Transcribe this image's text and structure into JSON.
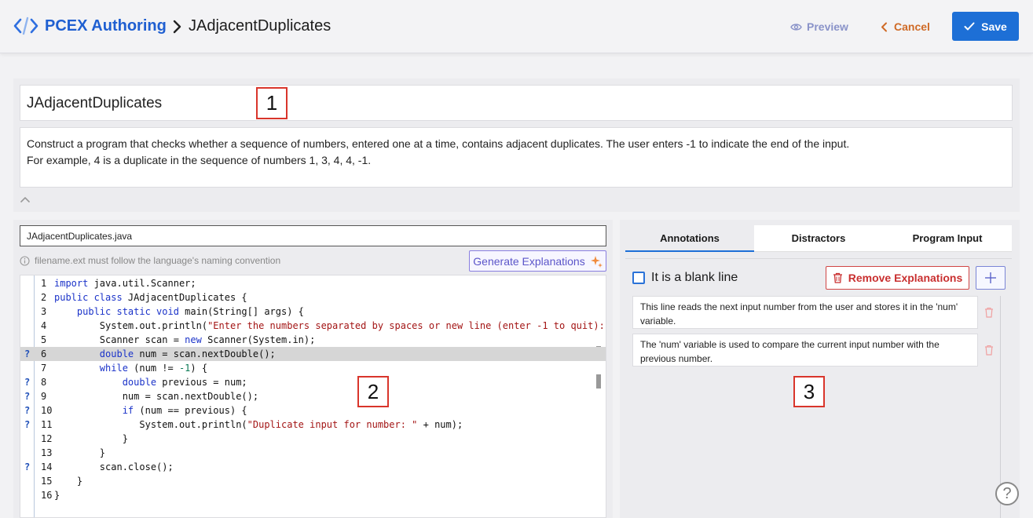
{
  "header": {
    "app_name": "PCEX Authoring",
    "breadcrumb_current": "JAdjacentDuplicates",
    "preview_label": "Preview",
    "cancel_label": "Cancel",
    "save_label": "Save"
  },
  "problem": {
    "title": "JAdjacentDuplicates",
    "description_line1": "Construct a program that checks whether a sequence of numbers, entered one at a time, contains adjacent duplicates. The user enters -1 to indicate the end of the input.",
    "description_line2": "For example, 4 is a duplicate in the sequence of numbers 1, 3, 4, 4, -1."
  },
  "editor": {
    "filename": "JAdjacentDuplicates.java",
    "filename_hint": "filename.ext must follow the language's naming convention",
    "generate_label": "Generate Explanations",
    "highlighted_line": 6,
    "lines": [
      {
        "n": "1",
        "marker": "",
        "indent": "",
        "segs": [
          [
            "kw",
            "import"
          ],
          [
            "t",
            " java.util.Scanner;"
          ]
        ]
      },
      {
        "n": "2",
        "marker": "",
        "indent": "",
        "segs": [
          [
            "kw",
            "public class"
          ],
          [
            "t",
            " JAdjacentDuplicates {"
          ]
        ]
      },
      {
        "n": "3",
        "marker": "",
        "indent": "    ",
        "segs": [
          [
            "kw",
            "public static void"
          ],
          [
            "t",
            " main(String[] args) {"
          ]
        ]
      },
      {
        "n": "4",
        "marker": "",
        "indent": "        ",
        "segs": [
          [
            "t",
            "System.out.println("
          ],
          [
            "str",
            "\"Enter the numbers separated by spaces or new line (enter -1 to quit):"
          ]
        ]
      },
      {
        "n": "5",
        "marker": "",
        "indent": "        ",
        "segs": [
          [
            "t",
            "Scanner scan = "
          ],
          [
            "kw",
            "new"
          ],
          [
            "t",
            " Scanner(System.in);"
          ]
        ]
      },
      {
        "n": "6",
        "marker": "?",
        "indent": "        ",
        "segs": [
          [
            "kw",
            "double"
          ],
          [
            "t",
            " num = scan.nextDouble();"
          ]
        ]
      },
      {
        "n": "7",
        "marker": "",
        "indent": "        ",
        "segs": [
          [
            "kw",
            "while"
          ],
          [
            "t",
            " (num != "
          ],
          [
            "num",
            "-1"
          ],
          [
            "t",
            ") {"
          ]
        ]
      },
      {
        "n": "8",
        "marker": "?",
        "indent": "            ",
        "segs": [
          [
            "kw",
            "double"
          ],
          [
            "t",
            " previous = num;"
          ]
        ]
      },
      {
        "n": "9",
        "marker": "?",
        "indent": "            ",
        "segs": [
          [
            "t",
            "num = scan.nextDouble();"
          ]
        ]
      },
      {
        "n": "10",
        "marker": "?",
        "indent": "            ",
        "segs": [
          [
            "kw",
            "if"
          ],
          [
            "t",
            " (num == previous) {"
          ]
        ]
      },
      {
        "n": "11",
        "marker": "?",
        "indent": "               ",
        "segs": [
          [
            "t",
            "System.out.println("
          ],
          [
            "str",
            "\"Duplicate input for number: \""
          ],
          [
            "t",
            " + num);"
          ]
        ]
      },
      {
        "n": "12",
        "marker": "",
        "indent": "            ",
        "segs": [
          [
            "t",
            "}"
          ]
        ]
      },
      {
        "n": "13",
        "marker": "",
        "indent": "        ",
        "segs": [
          [
            "t",
            "}"
          ]
        ]
      },
      {
        "n": "14",
        "marker": "?",
        "indent": "        ",
        "segs": [
          [
            "t",
            "scan.close();"
          ]
        ]
      },
      {
        "n": "15",
        "marker": "",
        "indent": "    ",
        "segs": [
          [
            "t",
            "}"
          ]
        ]
      },
      {
        "n": "16",
        "marker": "",
        "indent": "",
        "segs": [
          [
            "t",
            "}"
          ]
        ]
      }
    ]
  },
  "tabs": [
    {
      "label": "Annotations",
      "active": true
    },
    {
      "label": "Distractors",
      "active": false
    },
    {
      "label": "Program Input",
      "active": false
    }
  ],
  "annotations": {
    "blank_line_label": "It is a blank line",
    "blank_line_checked": false,
    "remove_label": "Remove Explanations",
    "items": [
      {
        "text": "This line reads the next input number from the user and stores it in the 'num' variable."
      },
      {
        "text": "The 'num' variable is used to compare the current input number with the previous number."
      }
    ]
  },
  "callouts": [
    "1",
    "2",
    "3"
  ],
  "help": {
    "symbol": "?"
  },
  "icons": {
    "logo": "code-brackets-icon",
    "breadcrumb": "chevron-right-icon",
    "preview": "eye-icon",
    "cancel": "chevron-left-icon",
    "save": "check-icon",
    "info": "info-circle-icon",
    "generate": "sparkle-icon",
    "remove": "trash-icon",
    "add": "plus-icon",
    "collapse": "chevron-up-icon"
  },
  "colors": {
    "brand": "#1f5fd1",
    "save_bg": "#1d6fd6",
    "cancel": "#cf6a26",
    "preview": "#8a93c9",
    "danger": "#c93030",
    "callout_border": "#d9352b"
  }
}
